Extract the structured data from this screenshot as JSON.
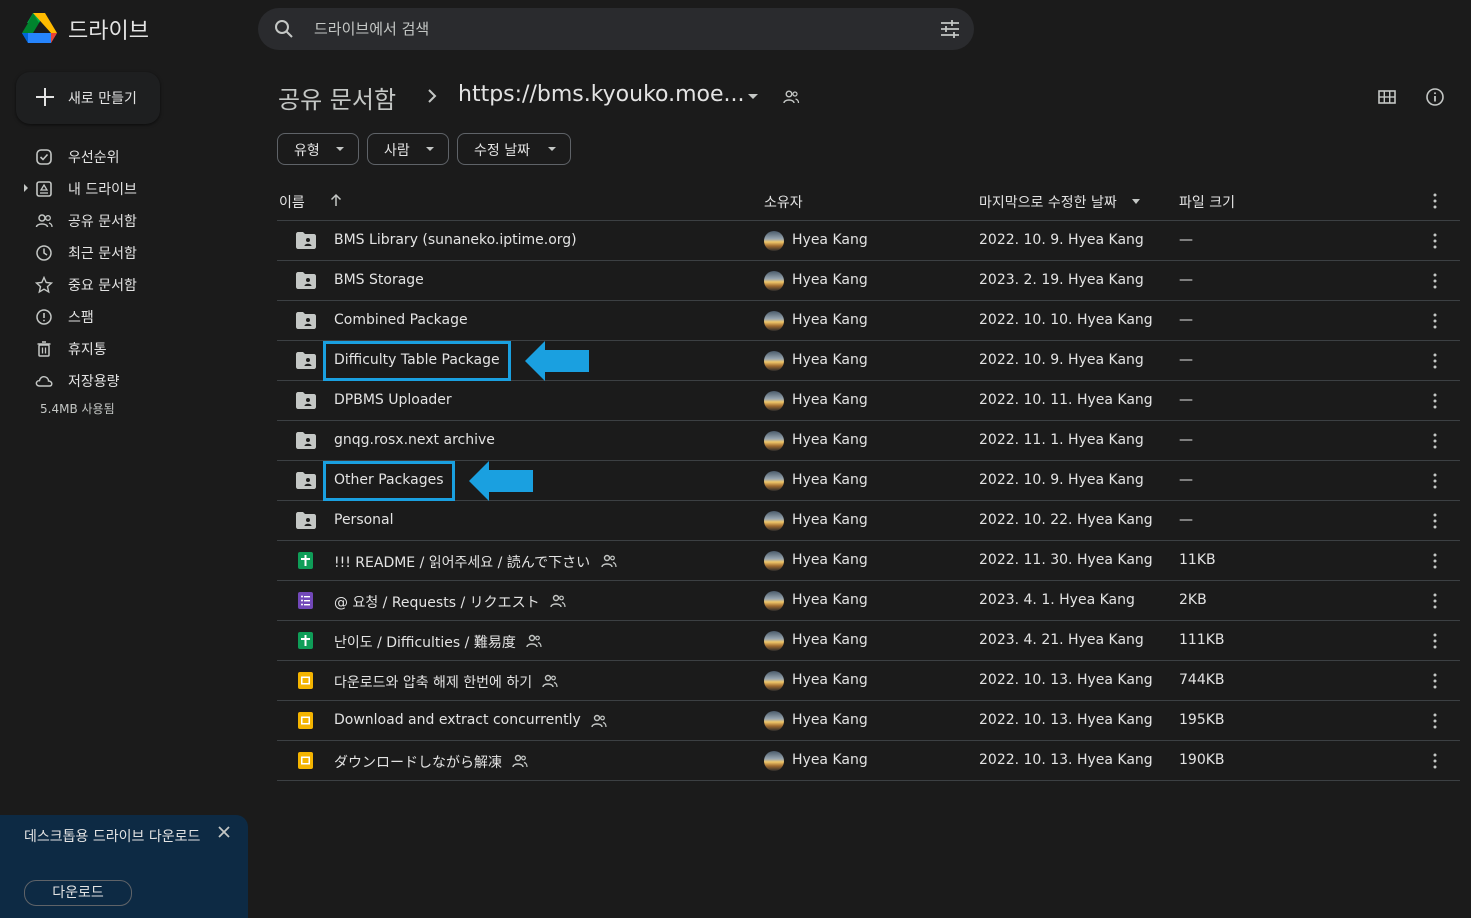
{
  "app": {
    "brand": "드라이브"
  },
  "search": {
    "placeholder": "드라이브에서 검색"
  },
  "new_button": {
    "label": "새로 만들기"
  },
  "sidebar": {
    "items": [
      {
        "label": "우선순위",
        "icon": "priority-icon"
      },
      {
        "label": "내 드라이브",
        "icon": "my-drive-icon"
      },
      {
        "label": "공유 문서함",
        "icon": "shared-icon"
      },
      {
        "label": "최근 문서함",
        "icon": "recent-icon"
      },
      {
        "label": "중요 문서함",
        "icon": "star-icon"
      },
      {
        "label": "스팸",
        "icon": "spam-icon"
      },
      {
        "label": "휴지통",
        "icon": "trash-icon"
      },
      {
        "label": "저장용량",
        "icon": "cloud-icon"
      }
    ],
    "storage_used": "5.4MB 사용됨"
  },
  "promo": {
    "text": "데스크톱용 드라이브 다운로드",
    "button": "다운로드"
  },
  "breadcrumb": {
    "root": "공유 문서함",
    "current": "https://bms.kyouko.moe..."
  },
  "filters": [
    {
      "label": "유형"
    },
    {
      "label": "사람"
    },
    {
      "label": "수정 날짜"
    }
  ],
  "columns": {
    "name": "이름",
    "owner": "소유자",
    "modified": "마지막으로 수정한 날짜",
    "size": "파일 크기"
  },
  "colors": {
    "background": "#1b1b1b",
    "highlight": "#1aa0e0",
    "folder": "#c4c7c5",
    "sheets": "#0f9d58",
    "forms": "#7248b9",
    "slides": "#f4b400"
  },
  "rows": [
    {
      "name": "BMS Library (sunaneko.iptime.org)",
      "type": "folder",
      "shared": false,
      "owner": "Hyea Kang",
      "modified": "2022. 10. 9. Hyea Kang",
      "size": "—"
    },
    {
      "name": "BMS Storage",
      "type": "folder",
      "shared": false,
      "owner": "Hyea Kang",
      "modified": "2023. 2. 19. Hyea Kang",
      "size": "—"
    },
    {
      "name": "Combined Package",
      "type": "folder",
      "shared": false,
      "owner": "Hyea Kang",
      "modified": "2022. 10. 10. Hyea Kang",
      "size": "—"
    },
    {
      "name": "Difficulty Table Package",
      "type": "folder",
      "shared": false,
      "owner": "Hyea Kang",
      "modified": "2022. 10. 9. Hyea Kang",
      "size": "—"
    },
    {
      "name": "DPBMS Uploader",
      "type": "folder",
      "shared": false,
      "owner": "Hyea Kang",
      "modified": "2022. 10. 11. Hyea Kang",
      "size": "—"
    },
    {
      "name": "gnqg.rosx.next archive",
      "type": "folder",
      "shared": false,
      "owner": "Hyea Kang",
      "modified": "2022. 11. 1. Hyea Kang",
      "size": "—"
    },
    {
      "name": "Other Packages",
      "type": "folder",
      "shared": false,
      "owner": "Hyea Kang",
      "modified": "2022. 10. 9. Hyea Kang",
      "size": "—"
    },
    {
      "name": "Personal",
      "type": "folder",
      "shared": false,
      "owner": "Hyea Kang",
      "modified": "2022. 10. 22. Hyea Kang",
      "size": "—"
    },
    {
      "name": "!!! README / 읽어주세요 / 読んで下さい",
      "type": "sheets",
      "shared": true,
      "owner": "Hyea Kang",
      "modified": "2022. 11. 30. Hyea Kang",
      "size": "11KB"
    },
    {
      "name": "@ 요청 / Requests / リクエスト",
      "type": "forms",
      "shared": true,
      "owner": "Hyea Kang",
      "modified": "2023. 4. 1. Hyea Kang",
      "size": "2KB"
    },
    {
      "name": "난이도 / Difficulties / 難易度",
      "type": "sheets",
      "shared": true,
      "owner": "Hyea Kang",
      "modified": "2023. 4. 21. Hyea Kang",
      "size": "111KB"
    },
    {
      "name": "다운로드와 압축 해제 한번에 하기",
      "type": "slides",
      "shared": true,
      "owner": "Hyea Kang",
      "modified": "2022. 10. 13. Hyea Kang",
      "size": "744KB"
    },
    {
      "name": "Download and extract concurrently",
      "type": "slides",
      "shared": true,
      "owner": "Hyea Kang",
      "modified": "2022. 10. 13. Hyea Kang",
      "size": "195KB"
    },
    {
      "name": "ダウンロードしながら解凍",
      "type": "slides",
      "shared": true,
      "owner": "Hyea Kang",
      "modified": "2022. 10. 13. Hyea Kang",
      "size": "190KB"
    }
  ],
  "highlighted_rows": [
    "Difficulty Table Package",
    "Other Packages"
  ]
}
